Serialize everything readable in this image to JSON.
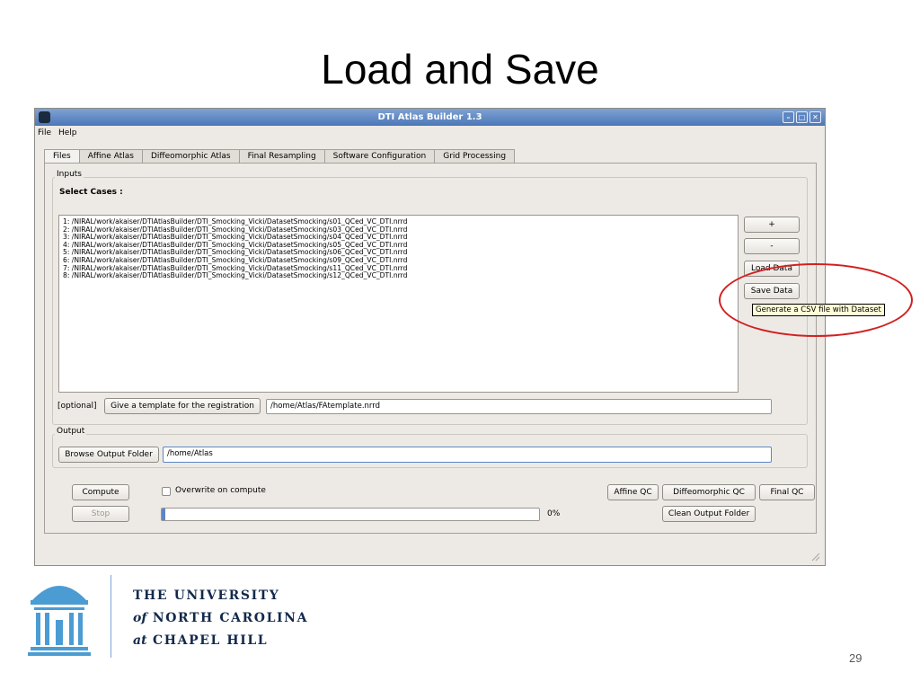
{
  "slide": {
    "title": "Load and Save",
    "page_number": "29"
  },
  "window": {
    "title": "DTI Atlas Builder 1.3",
    "controls": [
      "minimize-icon",
      "maximize-icon",
      "close-icon"
    ]
  },
  "menubar": {
    "items": [
      "File",
      "Help"
    ]
  },
  "tabs": [
    "Files",
    "Affine Atlas",
    "Diffeomorphic Atlas",
    "Final Resampling",
    "Software Configuration",
    "Grid Processing"
  ],
  "active_tab": "Files",
  "inputs": {
    "group_label": "Inputs",
    "select_cases_label": "Select Cases :",
    "cases": [
      "1: /NIRAL/work/akaiser/DTIAtlasBuilder/DTI_Smocking_Vicki/DatasetSmocking/s01_QCed_VC_DTI.nrrd",
      "2: /NIRAL/work/akaiser/DTIAtlasBuilder/DTI_Smocking_Vicki/DatasetSmocking/s03_QCed_VC_DTI.nrrd",
      "3: /NIRAL/work/akaiser/DTIAtlasBuilder/DTI_Smocking_Vicki/DatasetSmocking/s04_QCed_VC_DTI.nrrd",
      "4: /NIRAL/work/akaiser/DTIAtlasBuilder/DTI_Smocking_Vicki/DatasetSmocking/s05_QCed_VC_DTI.nrrd",
      "5: /NIRAL/work/akaiser/DTIAtlasBuilder/DTI_Smocking_Vicki/DatasetSmocking/s06_QCed_VC_DTI.nrrd",
      "6: /NIRAL/work/akaiser/DTIAtlasBuilder/DTI_Smocking_Vicki/DatasetSmocking/s09_QCed_VC_DTI.nrrd",
      "7: /NIRAL/work/akaiser/DTIAtlasBuilder/DTI_Smocking_Vicki/DatasetSmocking/s11_QCed_VC_DTI.nrrd",
      "8: /NIRAL/work/akaiser/DTIAtlasBuilder/DTI_Smocking_Vicki/DatasetSmocking/s12_QCed_VC_DTI.nrrd"
    ],
    "add_button": "+",
    "remove_button": "-",
    "load_data_button": "Load Data",
    "save_data_button": "Save Data",
    "save_data_tooltip": "Generate a CSV file with Dataset",
    "optional_label": "[optional]",
    "template_button": "Give a template for the registration",
    "template_path": "/home/Atlas/FAtemplate.nrrd"
  },
  "output": {
    "group_label": "Output",
    "browse_button": "Browse Output Folder",
    "output_path": "/home/Atlas"
  },
  "footer": {
    "compute_button": "Compute",
    "stop_button": "Stop",
    "overwrite_label": "Overwrite on compute",
    "overwrite_checked": false,
    "progress_percent": 0,
    "progress_label": "0%",
    "affine_qc_button": "Affine QC",
    "diffeomorphic_qc_button": "Diffeomorphic QC",
    "final_qc_button": "Final QC",
    "clean_output_button": "Clean Output Folder"
  },
  "logo": {
    "line1": "THE UNIVERSITY",
    "line2_prefix": "of",
    "line2": "NORTH CAROLINA",
    "line3_prefix": "at",
    "line3": "CHAPEL HILL"
  },
  "colors": {
    "highlight_ellipse": "#d22020",
    "titlebar": "#4b77b8",
    "logo_navy": "#13294b"
  }
}
